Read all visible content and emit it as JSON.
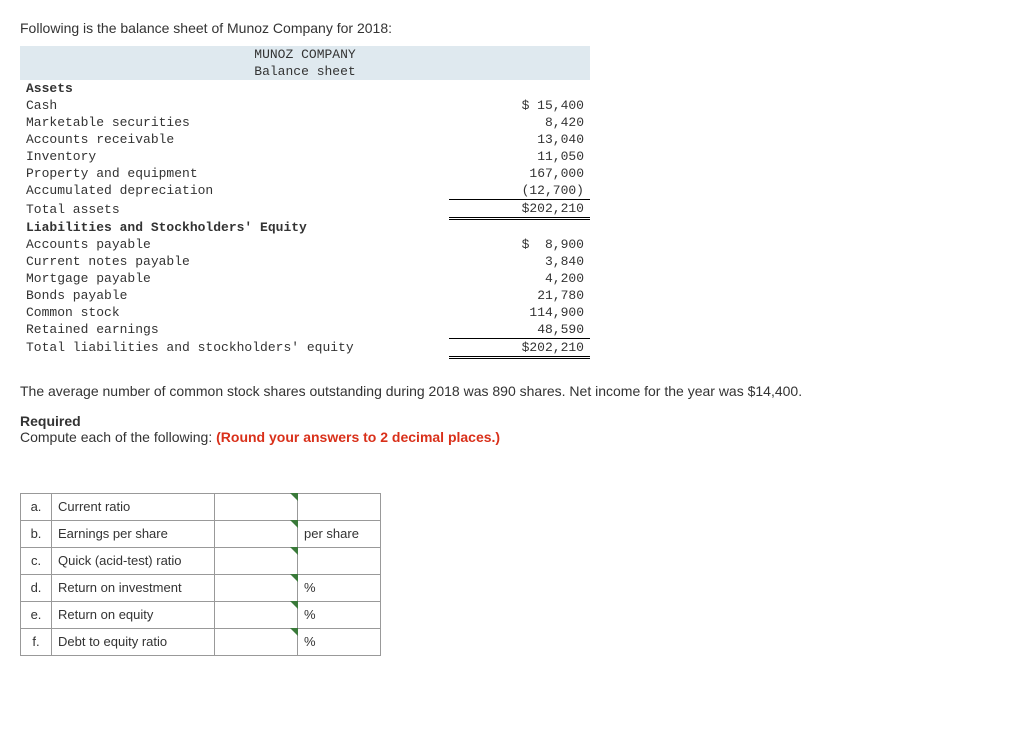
{
  "intro": "Following is the balance sheet of Munoz Company for 2018:",
  "bs": {
    "company": "MUNOZ COMPANY",
    "title": "Balance sheet",
    "section1": "Assets",
    "rows1": [
      {
        "label": "Cash",
        "amt": "$ 15,400"
      },
      {
        "label": "Marketable securities",
        "amt": "8,420"
      },
      {
        "label": "Accounts receivable",
        "amt": "13,040"
      },
      {
        "label": "Inventory",
        "amt": "11,050"
      },
      {
        "label": "Property and equipment",
        "amt": "167,000"
      },
      {
        "label": "Accumulated depreciation",
        "amt": "(12,700)"
      }
    ],
    "total1": {
      "label": "Total assets",
      "amt": "$202,210"
    },
    "section2": "Liabilities and Stockholders' Equity",
    "rows2": [
      {
        "label": "Accounts payable",
        "amt": "$  8,900"
      },
      {
        "label": "Current notes payable",
        "amt": "3,840"
      },
      {
        "label": "Mortgage payable",
        "amt": "4,200"
      },
      {
        "label": "Bonds payable",
        "amt": "21,780"
      },
      {
        "label": "Common stock",
        "amt": "114,900"
      },
      {
        "label": "Retained earnings",
        "amt": "48,590"
      }
    ],
    "total2": {
      "label": "Total liabilities and stockholders' equity",
      "amt": "$202,210"
    }
  },
  "para": "The average number of common stock shares outstanding during 2018 was 890 shares. Net income for the year was $14,400.",
  "required": {
    "head": "Required",
    "text": "Compute each of the following: ",
    "hint": "(Round your answers to 2 decimal places.)"
  },
  "answers": [
    {
      "letter": "a.",
      "label": "Current ratio",
      "unit": ""
    },
    {
      "letter": "b.",
      "label": "Earnings per share",
      "unit": "per share"
    },
    {
      "letter": "c.",
      "label": "Quick (acid-test) ratio",
      "unit": ""
    },
    {
      "letter": "d.",
      "label": "Return on investment",
      "unit": "%"
    },
    {
      "letter": "e.",
      "label": "Return on equity",
      "unit": "%"
    },
    {
      "letter": "f.",
      "label": "Debt to equity ratio",
      "unit": "%"
    }
  ]
}
